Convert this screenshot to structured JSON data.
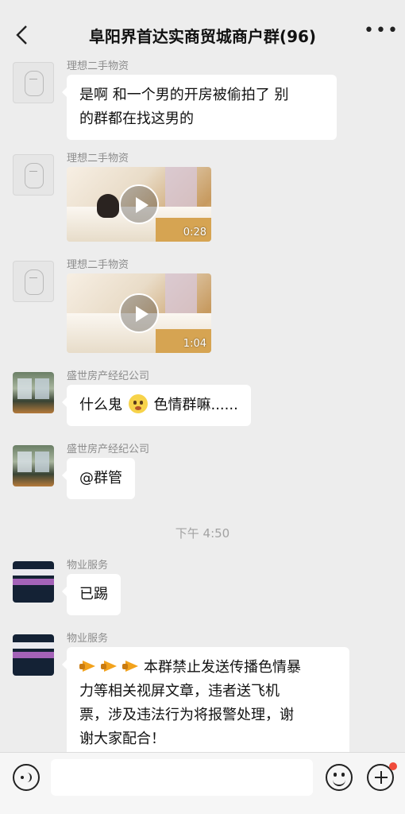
{
  "header": {
    "title": "阜阳界首达实商贸城商户群(96)",
    "back_icon": "back-chevron-icon",
    "more_icon": "more-dots-icon",
    "more_label": "•••"
  },
  "messages": [
    {
      "sender": "理想二手物资",
      "type": "text",
      "text_line1": "是啊 和一个男的开房被偷拍了 别",
      "text_line2": "的群都在找这男的"
    },
    {
      "sender": "理想二手物资",
      "type": "video",
      "duration": "0:28"
    },
    {
      "sender": "理想二手物资",
      "type": "video",
      "duration": "1:04"
    },
    {
      "sender": "盛世房产经纪公司",
      "type": "text",
      "text_before": "什么鬼",
      "emoji_icon": "flushed-face-icon",
      "text_after": "色情群嘛......"
    },
    {
      "sender": "盛世房产经纪公司",
      "type": "text",
      "text": "@群管"
    },
    {
      "sender": "物业服务",
      "type": "text",
      "text": "已踢"
    },
    {
      "sender": "物业服务",
      "type": "text",
      "icon": "megaphone-icon",
      "text_line1": "本群禁止发送传播色情暴",
      "text_line2": "力等相关视屏文章，违者送飞机",
      "text_line3": "票，涉及违法行为将报警处理，谢",
      "text_line4": "谢大家配合！"
    }
  ],
  "timestamp": "下午 4:50",
  "input_bar": {
    "voice_icon": "voice-icon",
    "emoji_icon": "emoji-face-icon",
    "plus_icon": "plus-icon",
    "notification_color": "#f04b3b"
  }
}
